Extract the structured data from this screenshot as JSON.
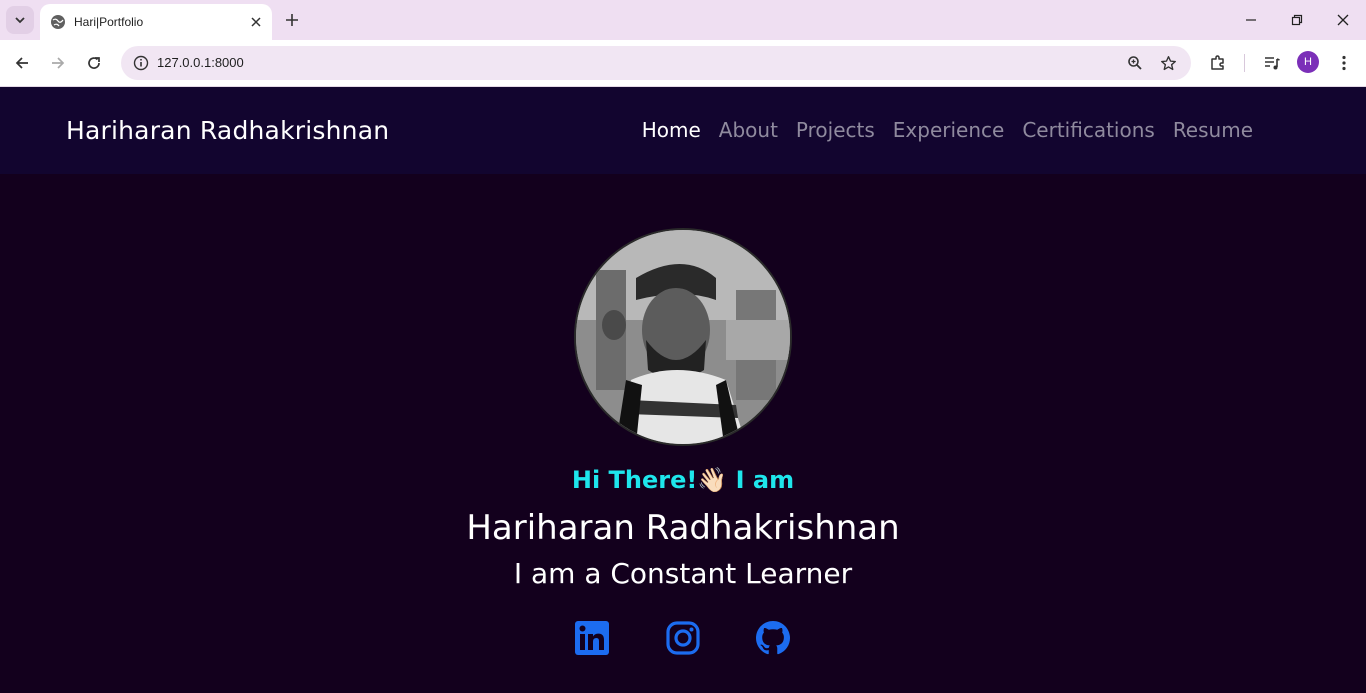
{
  "browser": {
    "tab_title": "Hari|Portfolio",
    "url": "127.0.0.1:8000",
    "profile_initial": "H"
  },
  "site": {
    "brand": "Hariharan Radhakrishnan",
    "nav": [
      {
        "label": "Home",
        "active": true
      },
      {
        "label": "About",
        "active": false
      },
      {
        "label": "Projects",
        "active": false
      },
      {
        "label": "Experience",
        "active": false
      },
      {
        "label": "Certifications",
        "active": false
      },
      {
        "label": "Resume",
        "active": false
      }
    ]
  },
  "hero": {
    "greeting_prefix": "Hi There!",
    "greeting_emoji": "👋🏻",
    "greeting_suffix": "I am",
    "name": "Hariharan Radhakrishnan",
    "tagline": "I am a Constant Learner",
    "socials": [
      "linkedin-icon",
      "instagram-icon",
      "github-icon"
    ]
  },
  "colors": {
    "page_bg": "#13001d",
    "nav_bg": "#12052f",
    "greeting": "#1ee6ec",
    "social_icon": "#1c6cf0",
    "nav_inactive": "#8f8a9e"
  }
}
